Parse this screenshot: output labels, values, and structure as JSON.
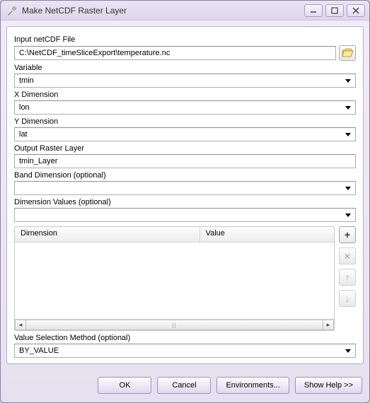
{
  "window": {
    "title": "Make NetCDF Raster Layer"
  },
  "fields": {
    "input_label": "Input netCDF File",
    "input_value": "C:\\NetCDF_timeSliceExport\\temperature.nc",
    "variable_label": "Variable",
    "variable_value": "tmin",
    "xdim_label": "X Dimension",
    "xdim_value": "lon",
    "ydim_label": "Y Dimension",
    "ydim_value": "lat",
    "output_label": "Output Raster Layer",
    "output_value": "tmin_Layer",
    "band_label": "Band Dimension (optional)",
    "band_value": "",
    "dimvals_label": "Dimension Values (optional)",
    "dimvals_value": "",
    "vsm_label": "Value Selection Method (optional)",
    "vsm_value": "BY_VALUE"
  },
  "table": {
    "col_dimension": "Dimension",
    "col_value": "Value"
  },
  "buttons": {
    "ok": "OK",
    "cancel": "Cancel",
    "environments": "Environments...",
    "show_help": "Show Help >>"
  }
}
